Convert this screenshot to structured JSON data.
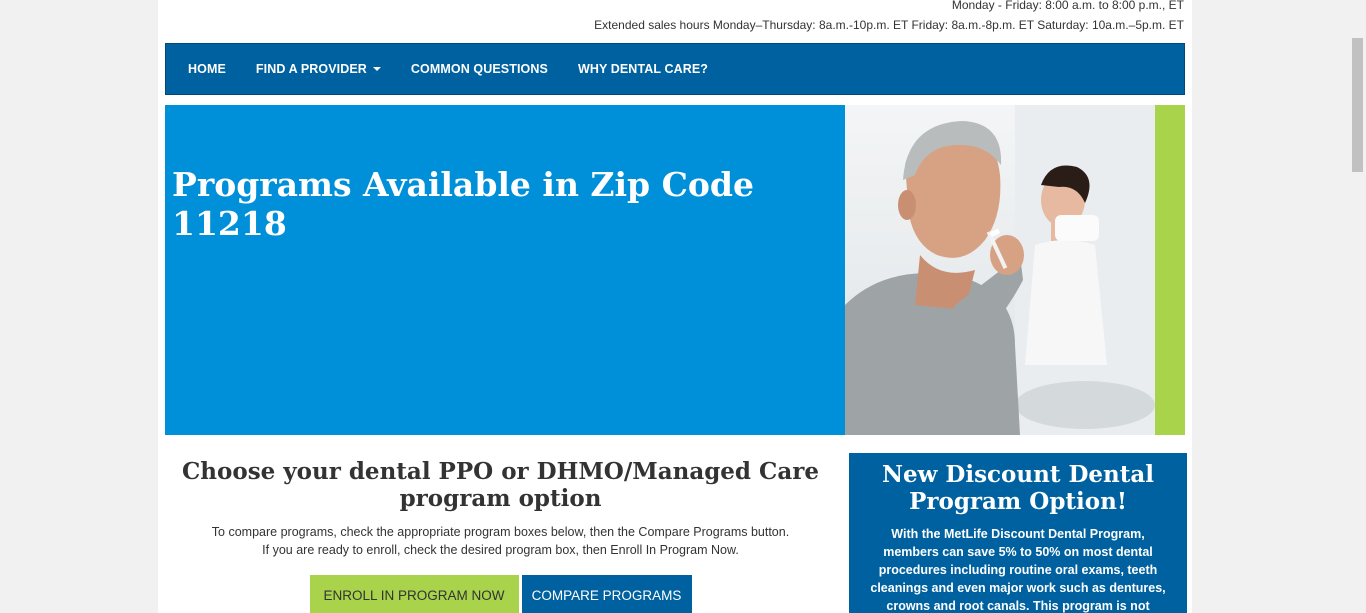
{
  "header": {
    "hours_line1": "Monday - Friday: 8:00 a.m. to 8:00 p.m., ET",
    "hours_line2": "Extended sales hours Monday–Thursday: 8a.m.-10p.m. ET Friday: 8a.m.-8p.m. ET Saturday: 10a.m.–5p.m. ET"
  },
  "nav": {
    "home": "HOME",
    "find_provider": "FIND A PROVIDER",
    "common_questions": "COMMON QUESTIONS",
    "why_dental": "WHY DENTAL CARE?"
  },
  "hero": {
    "title": "Programs Available in Zip Code 11218"
  },
  "main": {
    "heading": "Choose your dental PPO or DHMO/Managed Care program option",
    "instruction1": "To compare programs, check the appropriate program boxes below, then the Compare Programs button.",
    "instruction2": "If you are ready to enroll, check the desired program box, then Enroll In Program Now.",
    "enroll_button": "ENROLL IN PROGRAM NOW",
    "compare_button": "COMPARE PROGRAMS"
  },
  "promo": {
    "title": "New Discount Dental Program Option!",
    "text": "With the MetLife Discount Dental Program, members can save 5% to 50% on most dental procedures including routine oral exams, teeth cleanings and even major work such as dentures, crowns and root canals. This program is not available in Washington, Utah and"
  },
  "colors": {
    "nav_bg": "#0061a0",
    "hero_bg": "#0090da",
    "accent_green": "#a8d34a",
    "text_dark": "#333333"
  }
}
